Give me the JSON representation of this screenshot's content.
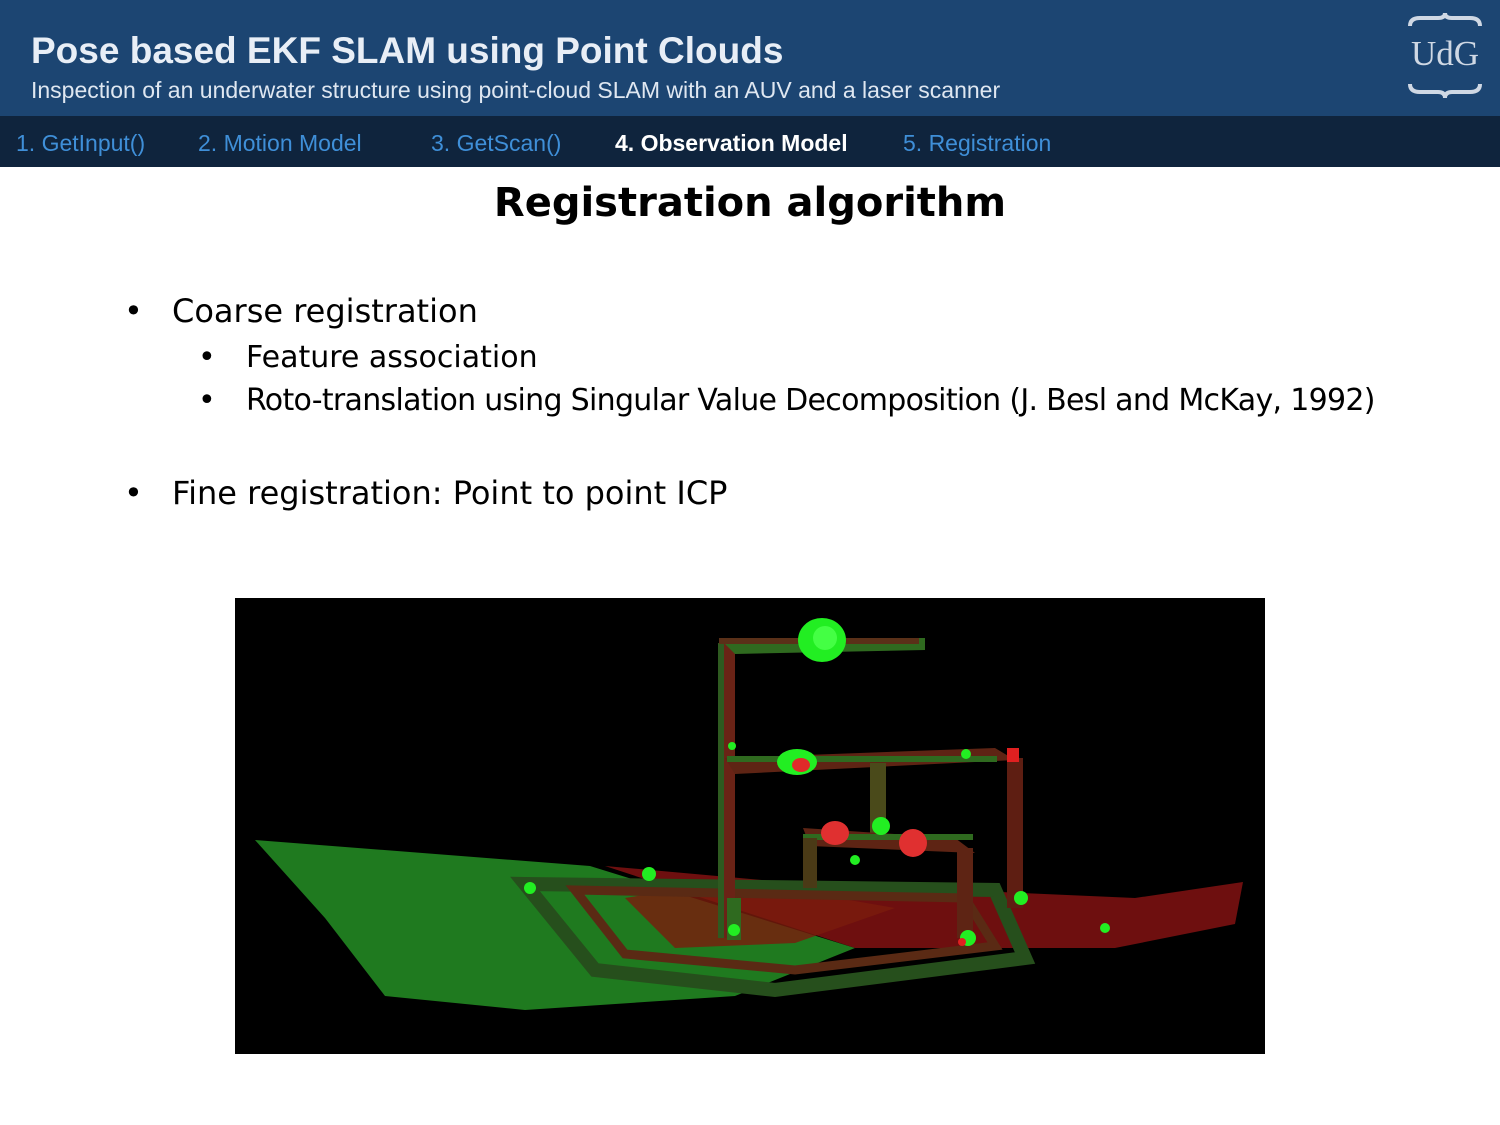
{
  "header": {
    "title": "Pose based EKF SLAM using Point Clouds",
    "subtitle": "Inspection of an underwater structure using point-cloud SLAM with an AUV and a laser scanner",
    "logo_text": "UdG"
  },
  "nav": {
    "items": [
      {
        "label": "1. GetInput()",
        "active": false
      },
      {
        "label": "2. Motion Model",
        "active": false
      },
      {
        "label": "3. GetScan()",
        "active": false
      },
      {
        "label": "4. Observation Model",
        "active": true
      },
      {
        "label": "5. Registration",
        "active": false
      }
    ]
  },
  "slide": {
    "heading": "Registration algorithm",
    "bullet_symbol": "•",
    "bullets": [
      {
        "text": "Coarse registration"
      },
      {
        "text": "Feature association"
      },
      {
        "text": "Roto-translation using Singular Value Decomposition (J. Besl and McKay, 1992)"
      },
      {
        "text": "Fine registration: Point to point ICP"
      }
    ]
  },
  "colors": {
    "header_bg": "#1c4572",
    "nav_bg": "#0f243d",
    "nav_link": "#3f8fd8",
    "nav_active": "#ffffff",
    "cloud_green": "#1f7a1f",
    "cloud_red": "#7a1010",
    "highlight_green": "#22ee22",
    "highlight_red": "#ee2222"
  },
  "figure": {
    "icon": "point-cloud-registration-image"
  }
}
